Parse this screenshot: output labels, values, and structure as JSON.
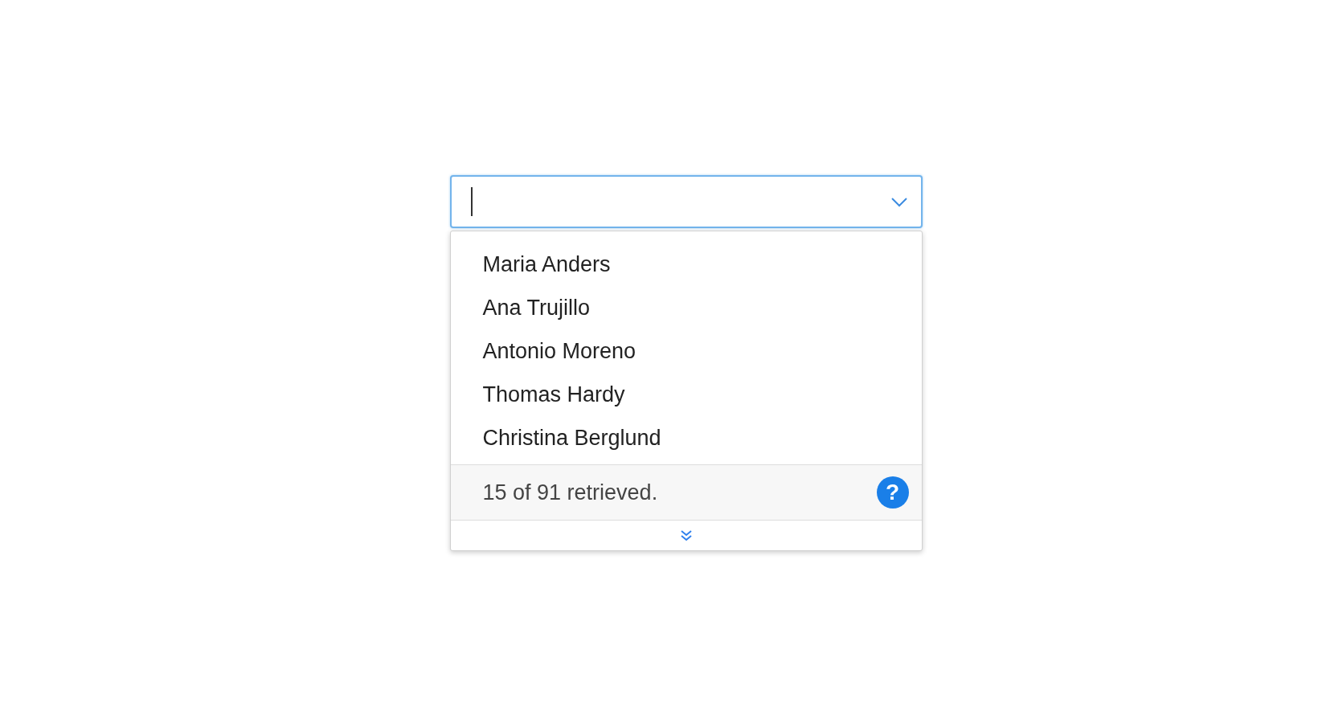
{
  "combobox": {
    "focused": true,
    "expanded": true
  },
  "dropdown": {
    "items": [
      {
        "label": "Maria Anders"
      },
      {
        "label": "Ana Trujillo"
      },
      {
        "label": "Antonio Moreno"
      },
      {
        "label": "Thomas Hardy"
      },
      {
        "label": "Christina Berglund"
      }
    ],
    "footer": {
      "status": "15 of 91 retrieved.",
      "help": "?"
    }
  }
}
